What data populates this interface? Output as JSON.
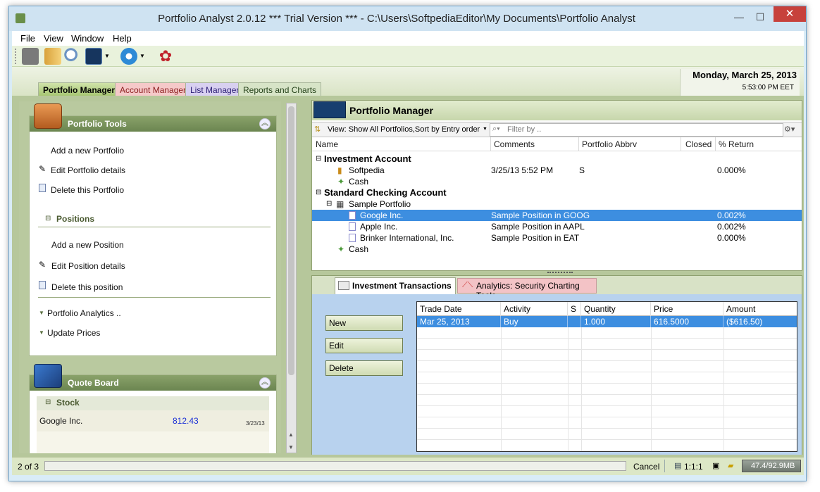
{
  "window": {
    "title": "Portfolio Analyst 2.0.12 *** Trial Version *** - C:\\Users\\SoftpediaEditor\\My Documents\\Portfolio Analyst",
    "minimize": "—",
    "maximize": "☐",
    "close": "✕"
  },
  "menu": [
    "File",
    "View",
    "Window",
    "Help"
  ],
  "header": {
    "date": "Monday, March 25, 2013",
    "time": "5:53:00 PM EET"
  },
  "tabs": [
    "Portfolio Manager",
    "Account Manager",
    "List Manager",
    "Reports and Charts"
  ],
  "left": {
    "tools_title": "Portfolio Tools",
    "tools": [
      "Add a new Portfolio",
      "Edit Portfolio details",
      "Delete this Portfolio"
    ],
    "positions_title": "Positions",
    "positions": [
      "Add a new Position",
      "Edit Position details",
      "Delete this position"
    ],
    "links": [
      "Portfolio Analytics ..",
      "Update Prices"
    ],
    "quote_title": "Quote Board",
    "stock_header": "Stock",
    "quotes": [
      {
        "name": "Google Inc.",
        "price": "812.43",
        "date": "3/23/13"
      }
    ]
  },
  "pm": {
    "title": "Portfolio Manager",
    "view_label": "View: Show All Portfolios,Sort by Entry order",
    "filter_placeholder": "Filter by ..",
    "columns": [
      "Name",
      "Comments",
      "Portfolio Abbrv",
      "Closed",
      "% Return"
    ],
    "rows": [
      {
        "type": "account",
        "name": "Investment Account"
      },
      {
        "type": "portfolio",
        "name": "Softpedia",
        "comments": "3/25/13 5:52 PM",
        "abbrv": "S",
        "ret": "0.000%"
      },
      {
        "type": "cash",
        "name": "Cash"
      },
      {
        "type": "account",
        "name": "Standard Checking Account"
      },
      {
        "type": "portfolio2",
        "name": "Sample Portfolio"
      },
      {
        "type": "position",
        "name": "Google Inc.",
        "comments": "Sample Position in GOOG",
        "ret": "0.002%",
        "selected": true
      },
      {
        "type": "position",
        "name": "Apple Inc.",
        "comments": "Sample Position in AAPL",
        "ret": "0.002%"
      },
      {
        "type": "position",
        "name": "Brinker International, Inc.",
        "comments": "Sample Position in EAT",
        "ret": "0.000%"
      },
      {
        "type": "cash",
        "name": "Cash"
      }
    ]
  },
  "tx": {
    "tabs": [
      "Investment Transactions",
      "Analytics: Security Charting Tools"
    ],
    "buttons": [
      "New",
      "Edit",
      "Delete"
    ],
    "columns": [
      "Trade Date",
      "Activity",
      "S",
      "Quantity",
      "Price",
      "Amount"
    ],
    "rows": [
      [
        "Mar 25, 2013",
        "Buy",
        "",
        "1.000",
        "616.5000",
        "($616.50)"
      ]
    ]
  },
  "status": {
    "page": "2 of 3",
    "cancel": "Cancel",
    "zoom": "1:1:1",
    "memory": "47.4/92.9MB"
  },
  "colors": {
    "selection": "#3d8ee0",
    "panel_green": "#b6c79b",
    "header_green": "#7b9460"
  }
}
